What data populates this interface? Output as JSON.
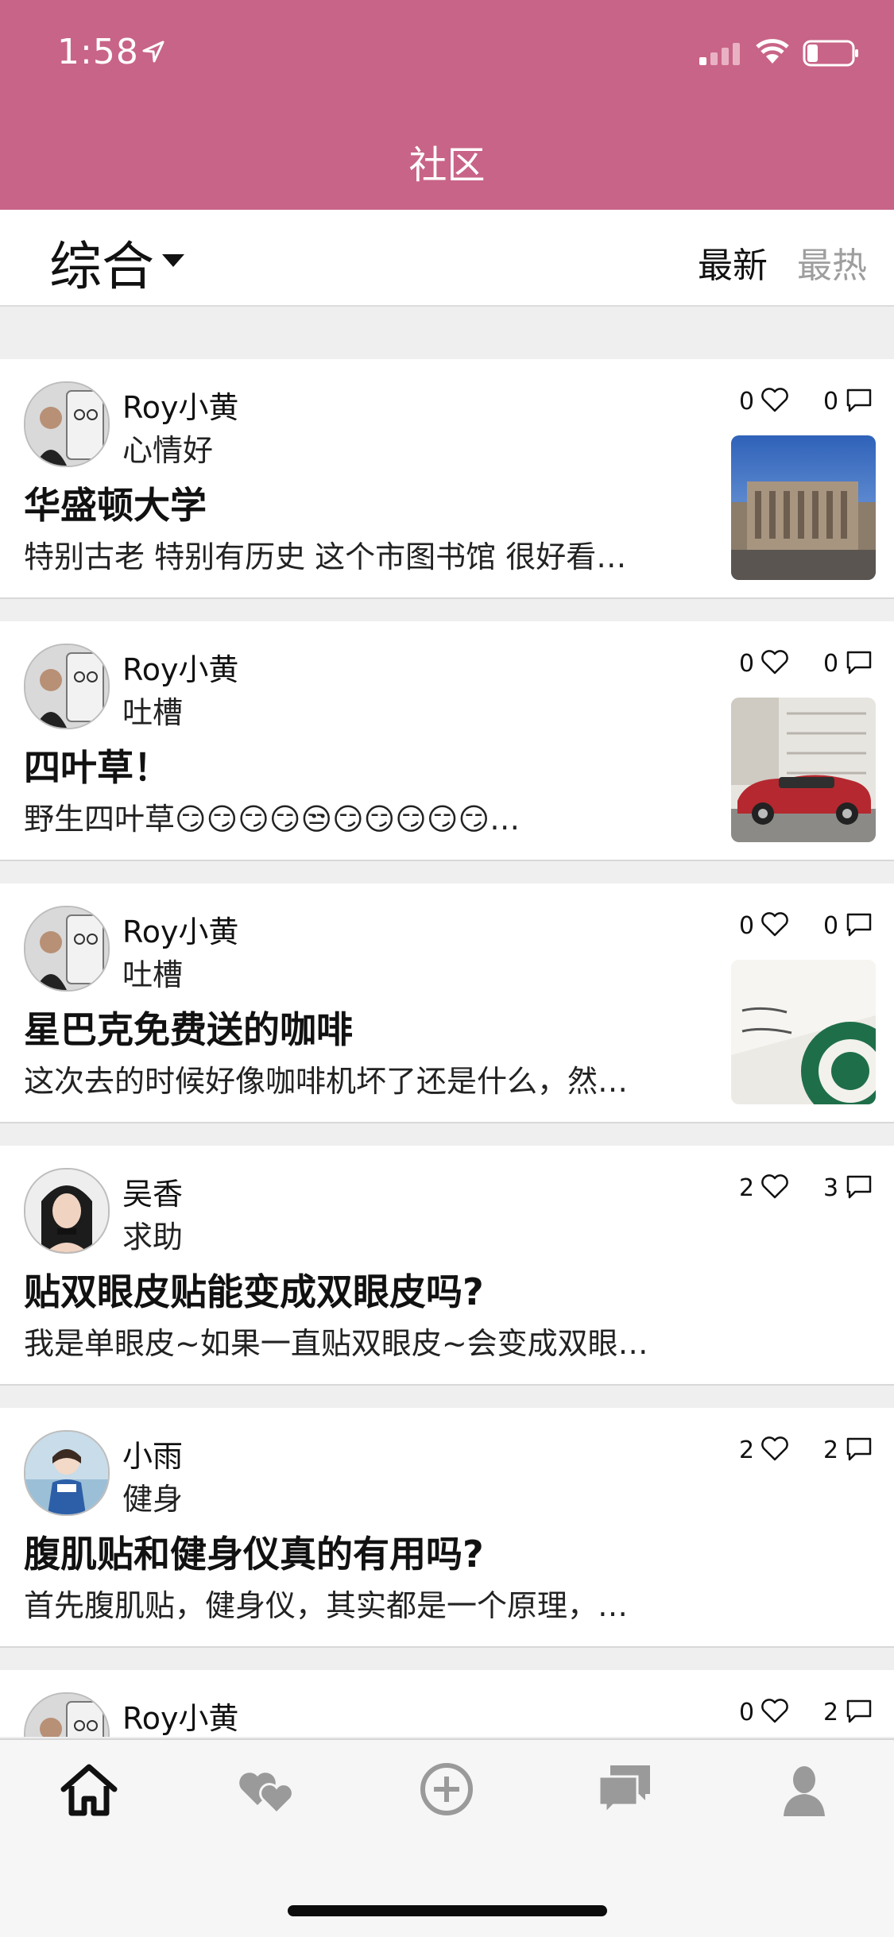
{
  "status_bar": {
    "time": "1:58"
  },
  "header": {
    "title": "社区"
  },
  "filter": {
    "label": "综合",
    "sort_options": [
      "最新",
      "最热"
    ],
    "active_sort": "最新"
  },
  "posts": [
    {
      "author": "Roy小黄",
      "category": "心情好",
      "title": "华盛顿大学",
      "excerpt": "特别古老 特别有历史 这个市图书馆  很好看…",
      "likes": "0",
      "comments": "0",
      "image": "library-photo"
    },
    {
      "author": "Roy小黄",
      "category": "吐槽",
      "title": "四叶草！",
      "excerpt": "野生四叶草😏😏😏😏😒😏😏😏😏😏…",
      "likes": "0",
      "comments": "0",
      "image": "red-car-photo"
    },
    {
      "author": "Roy小黄",
      "category": "吐槽",
      "title": "星巴克免费送的咖啡",
      "excerpt": "这次去的时候好像咖啡机坏了还是什么，然…",
      "likes": "0",
      "comments": "0",
      "image": "starbucks-card-photo"
    },
    {
      "author": "吴香",
      "category": "求助",
      "title": "贴双眼皮贴能变成双眼皮吗?",
      "excerpt": "我是单眼皮~如果一直贴双眼皮~会变成双眼…",
      "likes": "2",
      "comments": "3",
      "image": ""
    },
    {
      "author": "小雨",
      "category": "健身",
      "title": "腹肌贴和健身仪真的有用吗?",
      "excerpt": "首先腹肌贴，健身仪，其实都是一个原理，…",
      "likes": "2",
      "comments": "2",
      "image": ""
    },
    {
      "author": "Roy小黄",
      "category": "",
      "title": "",
      "excerpt": "",
      "likes": "0",
      "comments": "2",
      "image": ""
    }
  ],
  "tabbar": {
    "tabs": [
      "home-icon",
      "hearts-icon",
      "add-circle-icon",
      "chat-icon",
      "profile-icon"
    ],
    "active": "home-icon"
  },
  "colors": {
    "header": "#c86487",
    "active_tab": "#111111",
    "inactive_tab": "#9a9a9a"
  }
}
